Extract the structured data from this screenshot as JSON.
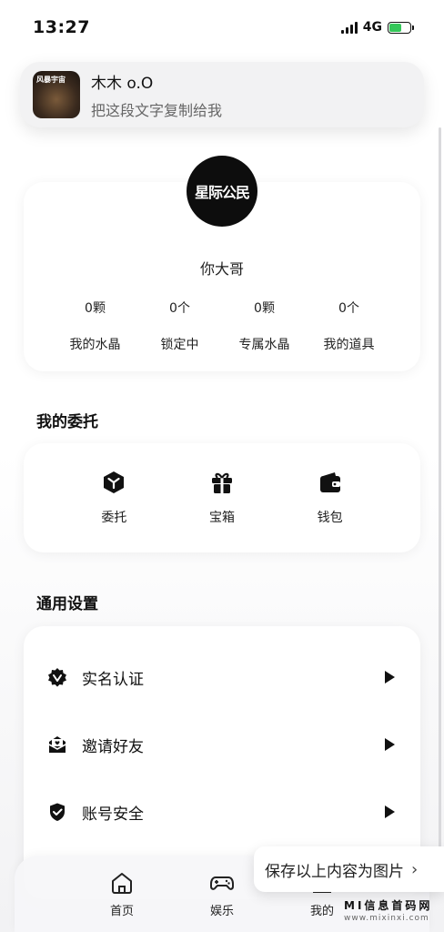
{
  "status_bar": {
    "time": "13:27",
    "network": "4G"
  },
  "notification": {
    "thumb_text": "风暴宇宙",
    "title": "木木 o.O",
    "subtitle": "把这段文字复制给我"
  },
  "profile": {
    "avatar_text": "星际公民",
    "username": "你大哥",
    "stats": [
      {
        "value": "0颗",
        "label": "我的水晶"
      },
      {
        "value": "0个",
        "label": "锁定中"
      },
      {
        "value": "0颗",
        "label": "专属水晶"
      },
      {
        "value": "0个",
        "label": "我的道具"
      }
    ]
  },
  "entrust": {
    "title": "我的委托",
    "items": [
      {
        "label": "委托",
        "icon": "box-icon"
      },
      {
        "label": "宝箱",
        "icon": "gift-icon"
      },
      {
        "label": "钱包",
        "icon": "wallet-icon"
      }
    ]
  },
  "settings": {
    "title": "通用设置",
    "items": [
      {
        "label": "实名认证",
        "icon": "verified-badge-icon"
      },
      {
        "label": "邀请好友",
        "icon": "invite-mail-icon"
      },
      {
        "label": "账号安全",
        "icon": "shield-check-icon"
      }
    ]
  },
  "tabbar": {
    "tabs": [
      {
        "label": "首页",
        "icon": "home-icon"
      },
      {
        "label": "娱乐",
        "icon": "gamepad-icon"
      },
      {
        "label": "我的",
        "icon": "profile-icon"
      }
    ]
  },
  "save_overlay": {
    "label": "保存以上内容为图片",
    "chevron": "›"
  },
  "watermark": {
    "title": "MI信息首码网",
    "url": "www.mixinxi.com"
  }
}
